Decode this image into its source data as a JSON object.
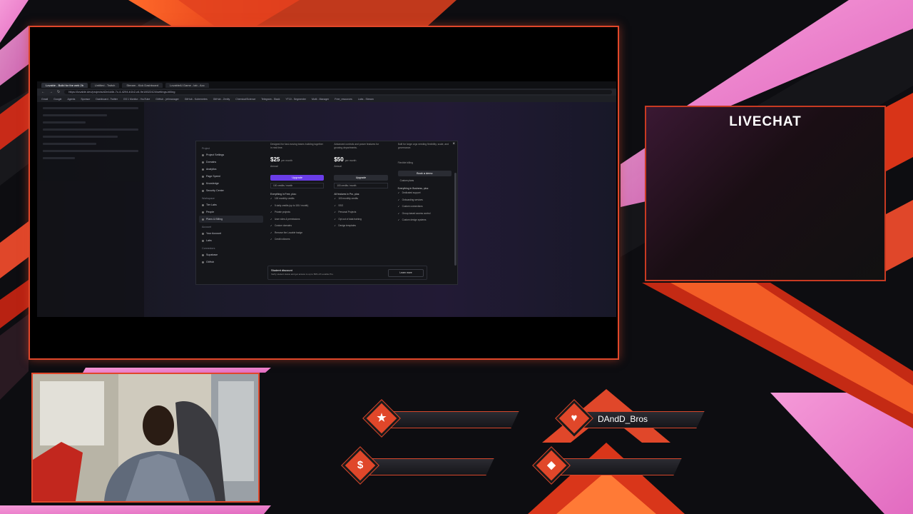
{
  "livechat": {
    "title": "LIVECHAT"
  },
  "alerts": {
    "follower": {
      "label": ""
    },
    "subscriber": {
      "label": "DAndD_Bros"
    },
    "donation": {
      "label": ""
    },
    "bits": {
      "label": ""
    }
  },
  "browser": {
    "tabs": [
      "Lovable - Build for the web 2b",
      "Untitled - Twitch",
      "Stream - Kick Dashboard",
      "LovableAI Game - lab - Acc"
    ],
    "url": "https://lovable.dev/projects/d2e4d4b-7c-4-4294-b1b2-c6-9e18022424/settings-billing",
    "bookmarks": [
      "Gmail",
      "Google",
      "Agents",
      "Sponsor",
      "Dashboard - Twitter",
      "GS 1 Monitor - YouTube",
      "GitHub - jet/manager",
      "GitHub - Kubernetes",
      "GitHub - Zenity",
      "Chemical/Science",
      "Telegram - Slack",
      "YT10 - Segmenter",
      "Multi - Manager",
      "Free_resources",
      "Labs - Stream"
    ]
  },
  "modal": {
    "nav": {
      "project_group": "Project",
      "project_items": [
        "Project Settings",
        "Domains",
        "Analytics",
        "Page Speed",
        "Knowledge",
        "Security Center"
      ],
      "workspace_group": "Workspace",
      "workspace_items": [
        "Tier Labs",
        "People",
        "Plans & Billing"
      ],
      "account_group": "Account",
      "account_items": [
        "Your Account",
        "Labs"
      ],
      "connectors_group": "Connectors",
      "connectors_items": [
        "Supabase",
        "GitHub"
      ]
    },
    "plans": [
      {
        "name": "Pro",
        "desc": "Designed for fast-moving teams building together in real time.",
        "price": "$25",
        "period": "per month",
        "toggle": "Annual",
        "button": "Upgrade",
        "select": "100 credits / month",
        "features_title": "Everything in Free, plus:",
        "features": [
          "100 monthly credits",
          "5 daily credits (up to 150 / month)",
          "Private projects",
          "User roles & permissions",
          "Custom domains",
          "Remove the Lovable badge",
          "Credit rollovers"
        ]
      },
      {
        "name": "Business",
        "desc": "Advanced controls and power features for growing departments.",
        "price": "$50",
        "period": "per month",
        "toggle": "Annual",
        "button": "Upgrade",
        "select": "100 credits / month",
        "features_title": "All features in Pro, plus:",
        "features": [
          "100 monthly credits",
          "SSO",
          "Personal Projects",
          "Opt out of data training",
          "Design templates"
        ]
      },
      {
        "name": "Enterprise",
        "desc": "Built for large orgs needing flexibility, scale, and governance.",
        "price": "",
        "period": "",
        "toggle": "Flexible billing",
        "button": "Book a demo",
        "select": "Custom plans",
        "features_title": "Everything in Business, plus:",
        "features": [
          "Dedicated support",
          "Onboarding services",
          "Custom connections",
          "Group-based access control",
          "Custom design systems"
        ]
      }
    ],
    "student": {
      "title": "Student discount",
      "desc": "Verify student status and get access to up to 50% off Lovable Pro.",
      "button": "Learn more"
    },
    "close": "×"
  }
}
